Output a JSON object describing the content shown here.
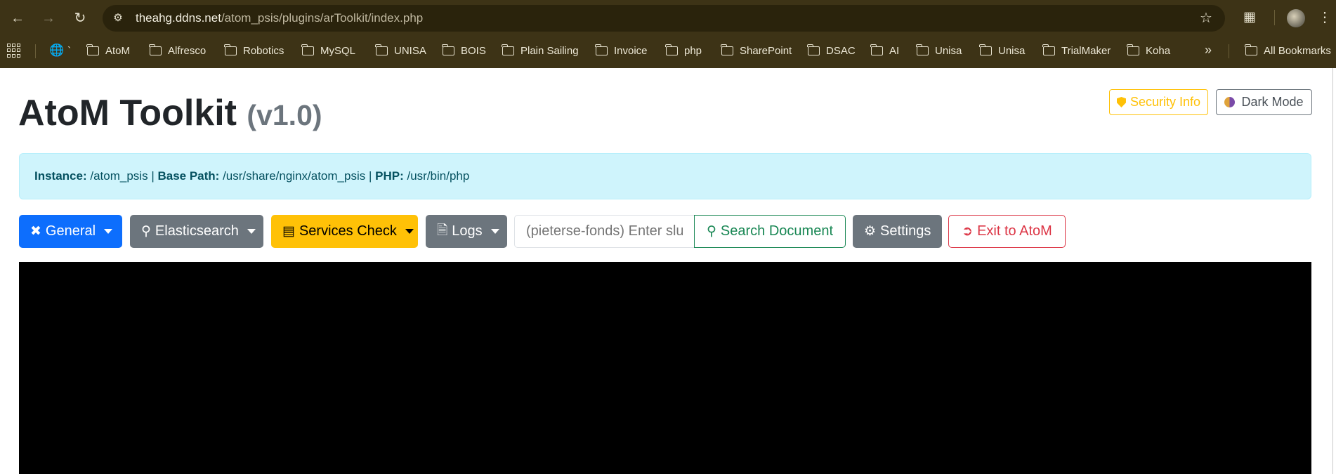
{
  "browser": {
    "url_host": "theahg.ddns.net",
    "url_path": "/atom_psis/plugins/arToolkit/index.php",
    "icons": {
      "back": "back-arrow-icon",
      "forward": "forward-arrow-icon",
      "reload": "reload-icon",
      "star": "star-icon",
      "extensions": "puzzle-icon",
      "menu": "more-vert-icon"
    },
    "bookmarks": [
      {
        "label": "`"
      },
      {
        "label": "AtoM"
      },
      {
        "label": "Alfresco"
      },
      {
        "label": "Robotics"
      },
      {
        "label": "MySQL"
      },
      {
        "label": "UNISA"
      },
      {
        "label": "BOIS"
      },
      {
        "label": "Plain Sailing"
      },
      {
        "label": "Invoice"
      },
      {
        "label": "php"
      },
      {
        "label": "SharePoint"
      },
      {
        "label": "DSAC"
      },
      {
        "label": "AI"
      },
      {
        "label": "Unisa"
      },
      {
        "label": "Unisa"
      },
      {
        "label": "TrialMaker"
      },
      {
        "label": "Koha"
      }
    ],
    "all_bookmarks": "All Bookmarks",
    "more": "»"
  },
  "header": {
    "title": "AtoM Toolkit",
    "version": "(v1.0)",
    "security_button": "Security Info",
    "dark_mode_button": "Dark Mode"
  },
  "info": {
    "instance_label": "Instance:",
    "instance_value": "/atom_psis",
    "sep1": "|",
    "base_path_label": "Base Path:",
    "base_path_value": "/usr/share/nginx/atom_psis",
    "sep2": "|",
    "php_label": "PHP:",
    "php_value": "/usr/bin/php"
  },
  "toolbar": {
    "general": "General",
    "elasticsearch": "Elasticsearch",
    "services_check": "Services Check",
    "logs": "Logs",
    "slug_placeholder": "(pieterse-fonds) Enter slug",
    "search_document": "Search Document",
    "settings": "Settings",
    "exit": "Exit to AtoM"
  },
  "colors": {
    "primary": "#0d6efd",
    "secondary": "#6c757d",
    "warning": "#ffc107",
    "success": "#198754",
    "danger": "#dc3545",
    "info_bg": "#cff4fc",
    "terminal_bg": "#000000"
  }
}
